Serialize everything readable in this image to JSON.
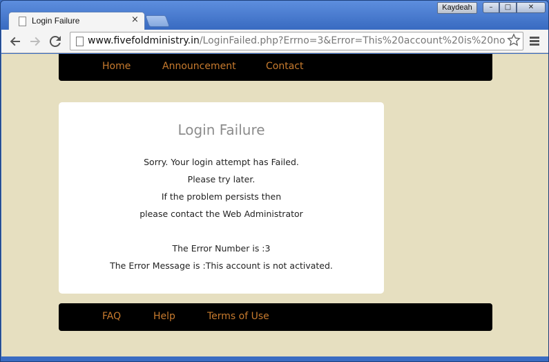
{
  "browser": {
    "tab_title": "Login Failure",
    "tab_close_glyph": "×",
    "user_name": "Kaydeah",
    "window_buttons": {
      "minimize": "–",
      "maximize": "□",
      "close": "✕"
    },
    "url_host": "www.fivefoldministry.in",
    "url_path": "/LoginFailed.php?Errno=3&Error=This%20account%20is%20no",
    "icons": {
      "back": "arrow-left-icon",
      "forward": "arrow-right-icon",
      "reload": "reload-icon",
      "bookmark": "star-icon",
      "menu": "hamburger-menu-icon"
    }
  },
  "nav": {
    "items": [
      {
        "label": "Home"
      },
      {
        "label": "Announcement"
      },
      {
        "label": "Contact"
      }
    ]
  },
  "main": {
    "title": "Login Failure",
    "lines": [
      "Sorry. Your login attempt has Failed.",
      "Please try later.",
      "If the problem persists then",
      "please contact the Web Administrator"
    ],
    "error_number_line": "The Error Number is :3",
    "error_message_line": "The Error Message is :This account is not activated."
  },
  "footer": {
    "items": [
      {
        "label": "FAQ"
      },
      {
        "label": "Help"
      },
      {
        "label": "Terms of Use"
      }
    ]
  },
  "colors": {
    "page_background": "#e6dfc0",
    "bar_background": "#000000",
    "link_color": "#c87b2e",
    "title_color": "#8c8c8c",
    "frame_color": "#3a6cc2"
  }
}
